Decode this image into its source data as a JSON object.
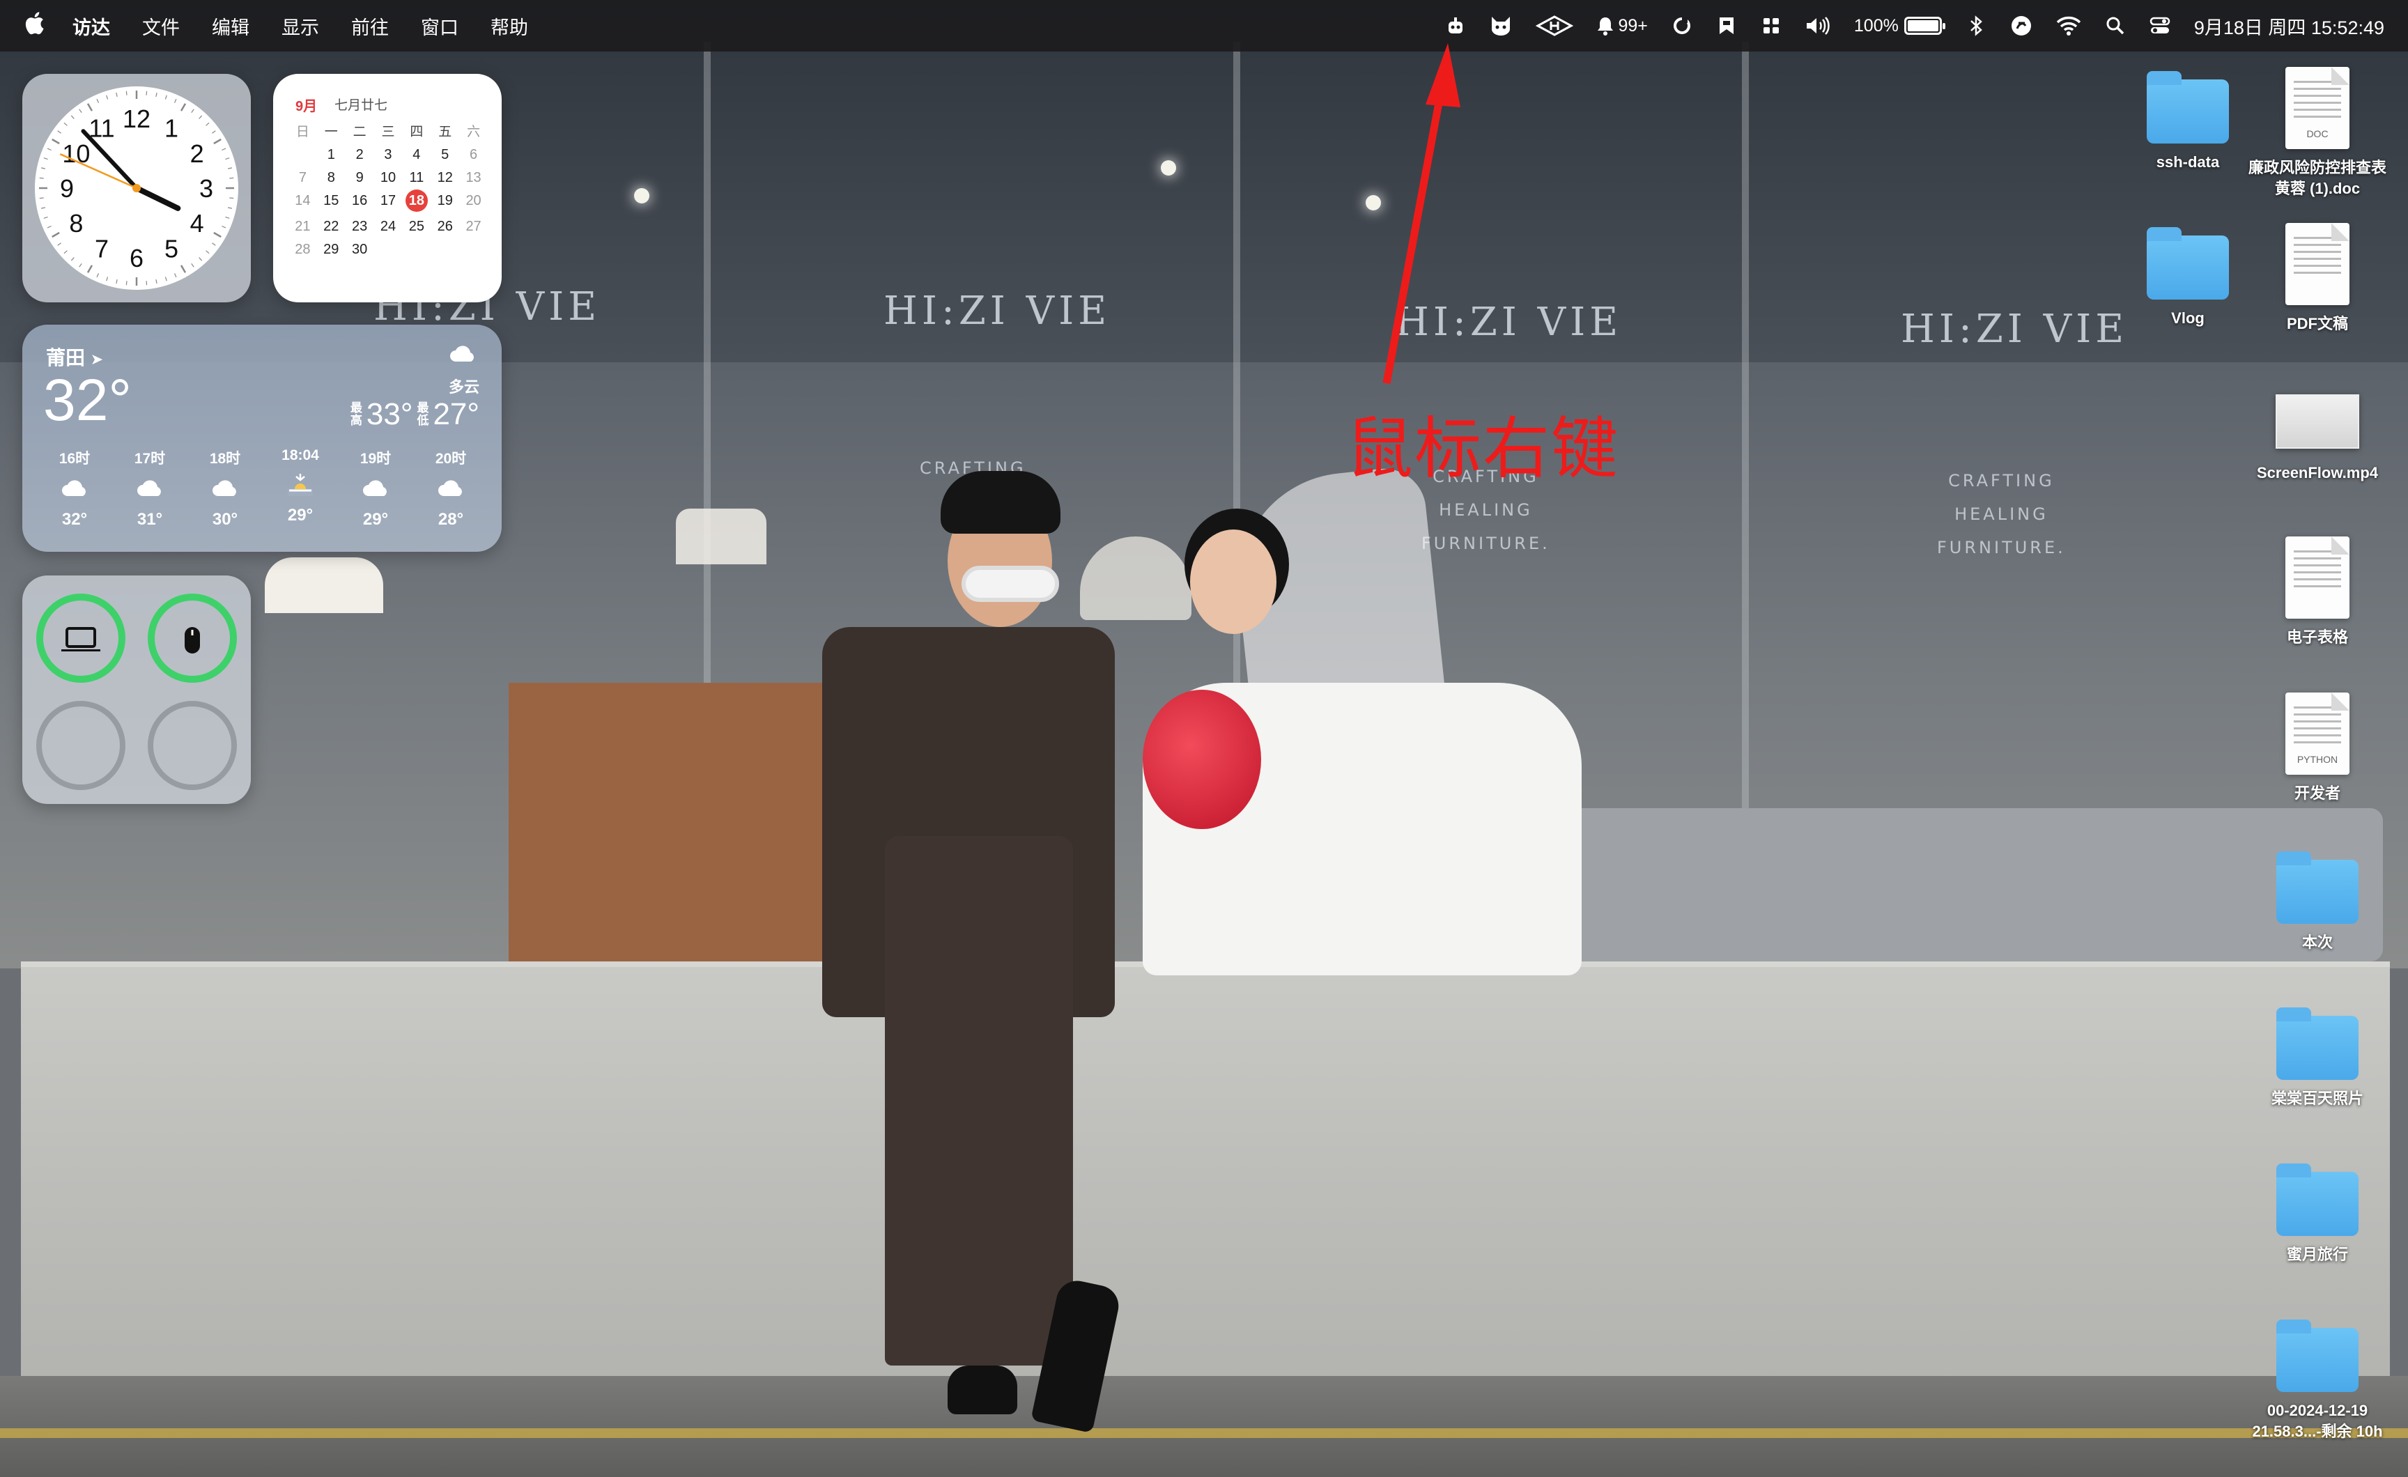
{
  "menubar": {
    "apple_glyph": "",
    "items": [
      "访达",
      "文件",
      "编辑",
      "显示",
      "前往",
      "窗口",
      "帮助"
    ],
    "status": {
      "notifications_count": "99+",
      "battery_percent": "100%",
      "battery_level": 1.0,
      "datetime": "9月18日 周四 15:52:49"
    }
  },
  "clock": {
    "numbers": [
      "12",
      "1",
      "2",
      "3",
      "4",
      "5",
      "6",
      "7",
      "8",
      "9",
      "10",
      "11"
    ],
    "hour": 3,
    "minute": 52,
    "second": 49
  },
  "calendar": {
    "month": "9月",
    "lunar": "七月廿七",
    "weekdays": [
      "日",
      "一",
      "二",
      "三",
      "四",
      "五",
      "六"
    ],
    "days": [
      "",
      "1",
      "2",
      "3",
      "4",
      "5",
      "6",
      "7",
      "8",
      "9",
      "10",
      "11",
      "12",
      "13",
      "14",
      "15",
      "16",
      "17",
      "18",
      "19",
      "20",
      "21",
      "22",
      "23",
      "24",
      "25",
      "26",
      "27",
      "28",
      "29",
      "30",
      "",
      "",
      "",
      ""
    ],
    "today": "18"
  },
  "weather": {
    "city": "莆田",
    "temp": "32°",
    "condition": "多云",
    "high_label": "最高",
    "high": "33°",
    "low_label": "最低",
    "low": "27°",
    "hours": [
      {
        "time": "16时",
        "icon": "cloud-icon",
        "temp": "32°"
      },
      {
        "time": "17时",
        "icon": "cloud-icon",
        "temp": "31°"
      },
      {
        "time": "18时",
        "icon": "cloud-icon",
        "temp": "30°"
      },
      {
        "time": "18:04",
        "icon": "sunset-icon",
        "temp": "29°"
      },
      {
        "time": "19时",
        "icon": "cloud-icon",
        "temp": "29°"
      },
      {
        "time": "20时",
        "icon": "cloud-icon",
        "temp": "28°"
      }
    ]
  },
  "batteries": {
    "devices": [
      {
        "icon": "laptop-icon",
        "level": 1.0
      },
      {
        "icon": "mouse-icon",
        "level": 1.0
      }
    ]
  },
  "wallpaper": {
    "sign_text": "HI:ZI VIE",
    "craft_lines": [
      "CRAFTING",
      "HEALING",
      "FURNITURE."
    ]
  },
  "desktop": {
    "icons": [
      {
        "kind": "folder",
        "label": "ssh-data"
      },
      {
        "kind": "doc",
        "label": "廉政风险防控排查表黄蓉 (1).doc",
        "tag": "DOC"
      },
      {
        "kind": "folder",
        "label": "Vlog"
      },
      {
        "kind": "doc",
        "label": "PDF文稿"
      },
      {
        "kind": "video",
        "label": "ScreenFlow.mp4"
      },
      {
        "kind": "doc",
        "label": "电子表格"
      },
      {
        "kind": "doc",
        "label": "开发者",
        "tag": "PYTHON"
      },
      {
        "kind": "folder",
        "label": "本次"
      },
      {
        "kind": "folder",
        "label": "棠棠百天照片"
      },
      {
        "kind": "folder",
        "label": "蜜月旅行"
      },
      {
        "kind": "folder",
        "label": "00-2024-12-19 21.58.3...-剩余 10h"
      }
    ]
  },
  "annotation": {
    "text": "鼠标右键",
    "color": "#ee1b1b"
  },
  "colors": {
    "menubar_bg": "#1c1c1e",
    "folder_blue": "#4aa9ea",
    "calendar_accent": "#e7413c",
    "battery_ring": "#3ed16a"
  }
}
